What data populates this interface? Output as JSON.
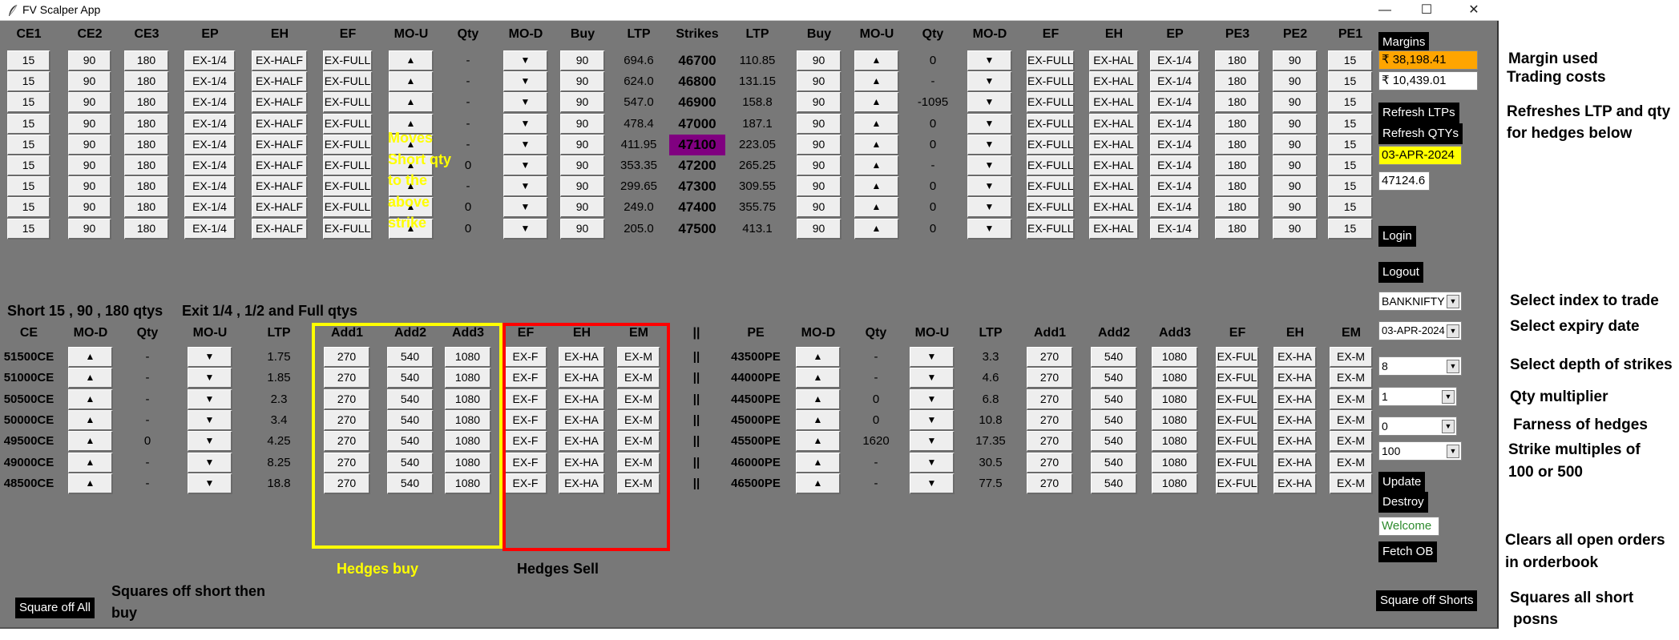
{
  "window": {
    "title": "FV Scalper App",
    "minimize": "—",
    "maximize": "☐",
    "close": "✕"
  },
  "top_headers": [
    "CE1",
    "CE2",
    "CE3",
    "EP",
    "EH",
    "EF",
    "MO-U",
    "Qty",
    "MO-D",
    "Buy",
    "LTP",
    "Strikes",
    "LTP",
    "Buy",
    "MO-U",
    "Qty",
    "MO-D",
    "EF",
    "EH",
    "EP",
    "PE3",
    "PE2",
    "PE1"
  ],
  "top_buttons": {
    "ce1": "15",
    "ce2": "90",
    "ce3": "180",
    "ep": "EX-1/4",
    "eh": "EX-HALF",
    "ef": "EX-FULL",
    "buy": "90",
    "ef_r": "EX-FULL",
    "eh_r": "EX-HAL",
    "ep_r": "EX-1/4",
    "pe3": "180",
    "pe2": "90",
    "pe1": "15",
    "up": "▲",
    "down": "▼"
  },
  "top_rows": [
    {
      "ce_qty": "-",
      "ce_ltp": "694.6",
      "strike": "46700",
      "pe_ltp": "110.85",
      "pe_qty": "0"
    },
    {
      "ce_qty": "-",
      "ce_ltp": "624.0",
      "strike": "46800",
      "pe_ltp": "131.15",
      "pe_qty": "-"
    },
    {
      "ce_qty": "-",
      "ce_ltp": "547.0",
      "strike": "46900",
      "pe_ltp": "158.8",
      "pe_qty": "-1095"
    },
    {
      "ce_qty": "-",
      "ce_ltp": "478.4",
      "strike": "47000",
      "pe_ltp": "187.1",
      "pe_qty": "0"
    },
    {
      "ce_qty": "-",
      "ce_ltp": "411.95",
      "strike": "47100",
      "pe_ltp": "223.05",
      "pe_qty": "0"
    },
    {
      "ce_qty": "0",
      "ce_ltp": "353.35",
      "strike": "47200",
      "pe_ltp": "265.25",
      "pe_qty": "-"
    },
    {
      "ce_qty": "-",
      "ce_ltp": "299.65",
      "strike": "47300",
      "pe_ltp": "309.55",
      "pe_qty": "0"
    },
    {
      "ce_qty": "0",
      "ce_ltp": "249.0",
      "strike": "47400",
      "pe_ltp": "355.75",
      "pe_qty": "0"
    },
    {
      "ce_qty": "0",
      "ce_ltp": "205.0",
      "strike": "47500",
      "pe_ltp": "413.1",
      "pe_qty": "0"
    }
  ],
  "atm_color": "#800080",
  "notes": {
    "short_qtys": "Short 15 , 90 , 180 qtys",
    "exit_qtys": "Exit 1/4 , 1/2 and Full qtys",
    "moves_lines": [
      "Moves",
      "Short qty",
      "to the",
      "above",
      "strike"
    ],
    "hedges_buy": "Hedges buy",
    "hedges_sell": "Hedges Sell",
    "square_off_all_desc": [
      "Squares off short then",
      "buy"
    ]
  },
  "hedge_headers": [
    "CE",
    "MO-D",
    "Qty",
    "MO-U",
    "LTP",
    "Add1",
    "Add2",
    "Add3",
    "EF",
    "EH",
    "EM",
    "||",
    "PE",
    "MO-D",
    "Qty",
    "MO-U",
    "LTP",
    "Add1",
    "Add2",
    "Add3",
    "EF",
    "EH",
    "EM"
  ],
  "hedge_buttons": {
    "add1": "270",
    "add2": "540",
    "add3": "1080",
    "ef": "EX-F",
    "eh": "EX-HA",
    "em": "EX-M",
    "pe_ef": "EX-FUL",
    "sep": "||"
  },
  "hedge_rows": [
    {
      "ce": "51500CE",
      "ce_qty": "-",
      "ce_ltp": "1.75",
      "pe": "43500PE",
      "pe_qty": "-",
      "pe_ltp": "3.3"
    },
    {
      "ce": "51000CE",
      "ce_qty": "-",
      "ce_ltp": "1.85",
      "pe": "44000PE",
      "pe_qty": "-",
      "pe_ltp": "4.6"
    },
    {
      "ce": "50500CE",
      "ce_qty": "-",
      "ce_ltp": "2.3",
      "pe": "44500PE",
      "pe_qty": "0",
      "pe_ltp": "6.8"
    },
    {
      "ce": "50000CE",
      "ce_qty": "-",
      "ce_ltp": "3.4",
      "pe": "45000PE",
      "pe_qty": "0",
      "pe_ltp": "10.8"
    },
    {
      "ce": "49500CE",
      "ce_qty": "0",
      "ce_ltp": "4.25",
      "pe": "45500PE",
      "pe_qty": "1620",
      "pe_ltp": "17.35"
    },
    {
      "ce": "49000CE",
      "ce_qty": "-",
      "ce_ltp": "8.25",
      "pe": "46000PE",
      "pe_qty": "-",
      "pe_ltp": "30.5"
    },
    {
      "ce": "48500CE",
      "ce_qty": "-",
      "ce_ltp": "18.8",
      "pe": "46500PE",
      "pe_qty": "-",
      "pe_ltp": "77.5"
    }
  ],
  "right_panel": {
    "margins_label": "Margins",
    "margin_used": "₹ 38,198.41",
    "margin_used_bg": "#ffa500",
    "trading_costs": "₹ 10,439.01",
    "refresh_ltps": "Refresh LTPs",
    "refresh_qtys": "Refresh QTYs",
    "expiry_display": "03-APR-2024",
    "expiry_bg": "#ffff00",
    "spot": "47124.6",
    "login": "Login",
    "logout": "Logout",
    "index_select": "BANKNIFTY",
    "expiry_select": "03-APR-2024",
    "depth_select": "8",
    "qty_mult_select": "1",
    "hedge_far_select": "0",
    "strike_mult_select": "100",
    "update": "Update",
    "destroy": "Destroy",
    "status": "Welcome",
    "status_color": "#2e8b2e",
    "fetch_ob": "Fetch OB",
    "square_off_shorts": "Square off Shorts",
    "square_off_all": "Square off All"
  },
  "side_notes": {
    "margin_used": "Margin used",
    "trading_costs": "Trading costs",
    "refresh_1": "Refreshes LTP and qty",
    "refresh_2": "for hedges below",
    "select_index": "Select index to trade",
    "select_expiry": "Select expiry date",
    "select_depth": "Select depth of strikes",
    "qty_multiplier": "Qty multiplier",
    "farness": "Farness of hedges",
    "strike_mult_1": "Strike multiples of",
    "strike_mult_2": "100 or 500",
    "clears_1": "Clears all open orders",
    "clears_2": "in orderbook",
    "squares_1": "Squares all short",
    "squares_2": "posns"
  }
}
